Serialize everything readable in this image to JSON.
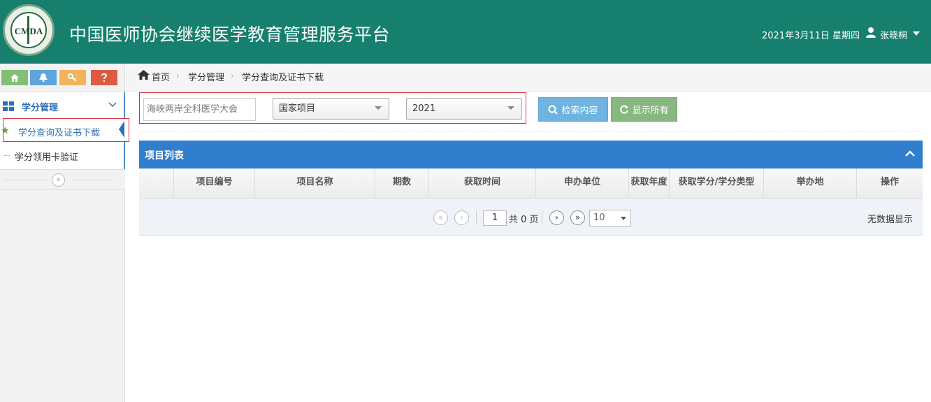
{
  "header": {
    "logo_text": "CMDA",
    "site_title": "中国医师协会继续医学教育管理服务平台",
    "date": "2021年3月11日 星期四",
    "user_name": "张晓桐"
  },
  "sidebar": {
    "group_label": "学分管理",
    "items": [
      {
        "label": "学分查询及证书下载",
        "active": true
      },
      {
        "label": "学分领用卡验证",
        "active": false
      }
    ],
    "collapse_icon": "«"
  },
  "breadcrumb": [
    "首页",
    "学分管理",
    "学分查询及证书下载"
  ],
  "search": {
    "project_name_value": "海峡两岸全科医学大会",
    "project_type_value": "国家项目",
    "year_value": "2021",
    "search_button": "检索内容",
    "show_all_button": "显示所有"
  },
  "table": {
    "title": "项目列表",
    "columns": [
      "",
      "项目编号",
      "项目名称",
      "期数",
      "获取时间",
      "申办单位",
      "获取年度",
      "获取学分/学分类型",
      "举办地",
      "操作"
    ],
    "rows": []
  },
  "pager": {
    "page_value": "1",
    "total_text": "共 0 页",
    "page_size": "10",
    "empty_text": "无数据显示"
  },
  "colors": {
    "header_bg": "#167f6d",
    "panel_head": "#307ecc",
    "search_btn": "#6fb3e0",
    "showall_btn": "#87b87f",
    "highlight_border": "#d9343a"
  }
}
